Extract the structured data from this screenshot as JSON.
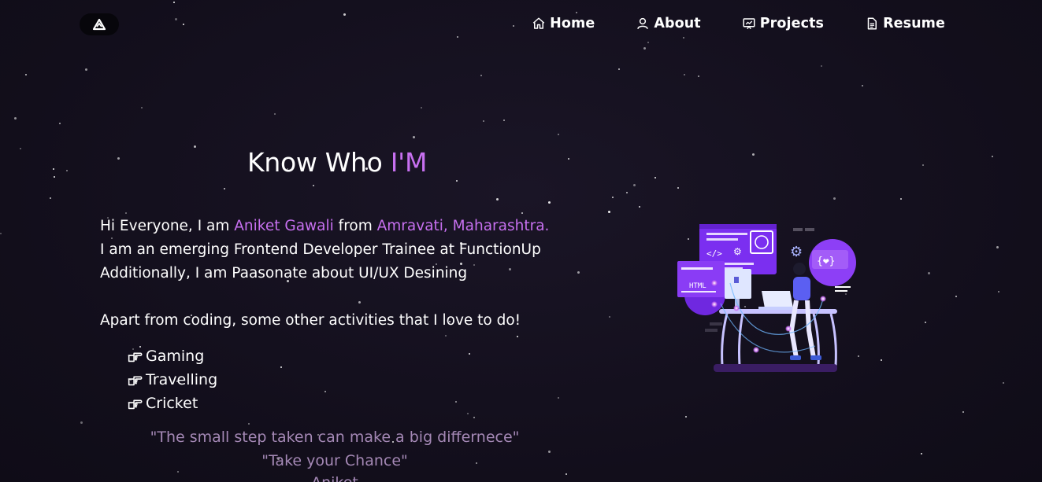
{
  "nav": {
    "logo_icon": "logo-mark-icon",
    "items": [
      {
        "label": "Home",
        "icon": "home-icon"
      },
      {
        "label": "About",
        "icon": "user-icon"
      },
      {
        "label": "Projects",
        "icon": "projects-icon"
      },
      {
        "label": "Resume",
        "icon": "document-icon"
      }
    ]
  },
  "about": {
    "heading_prefix": "Know Who ",
    "heading_accent": "I'M",
    "line1_prefix": "Hi Everyone, I am ",
    "name": "Aniket Gawali",
    "line1_mid": " from ",
    "location": "Amravati, Maharashtra.",
    "line2": "I am an emerging Frontend Developer Trainee at FunctionUp",
    "line3": "Additionally, I am Paasonate about UI/UX Desining",
    "line4": "Apart from coding, some other activities that I love to do!",
    "activities": [
      "Gaming",
      "Travelling",
      "Cricket"
    ],
    "quote": "\"The small step taken can make a big differnece\"",
    "quote2": "\"Take your Chance\"",
    "quote_author": "Aniket"
  },
  "colors": {
    "accent": "#c770f0",
    "background": "#130f1d",
    "quote": "#a488b5"
  }
}
